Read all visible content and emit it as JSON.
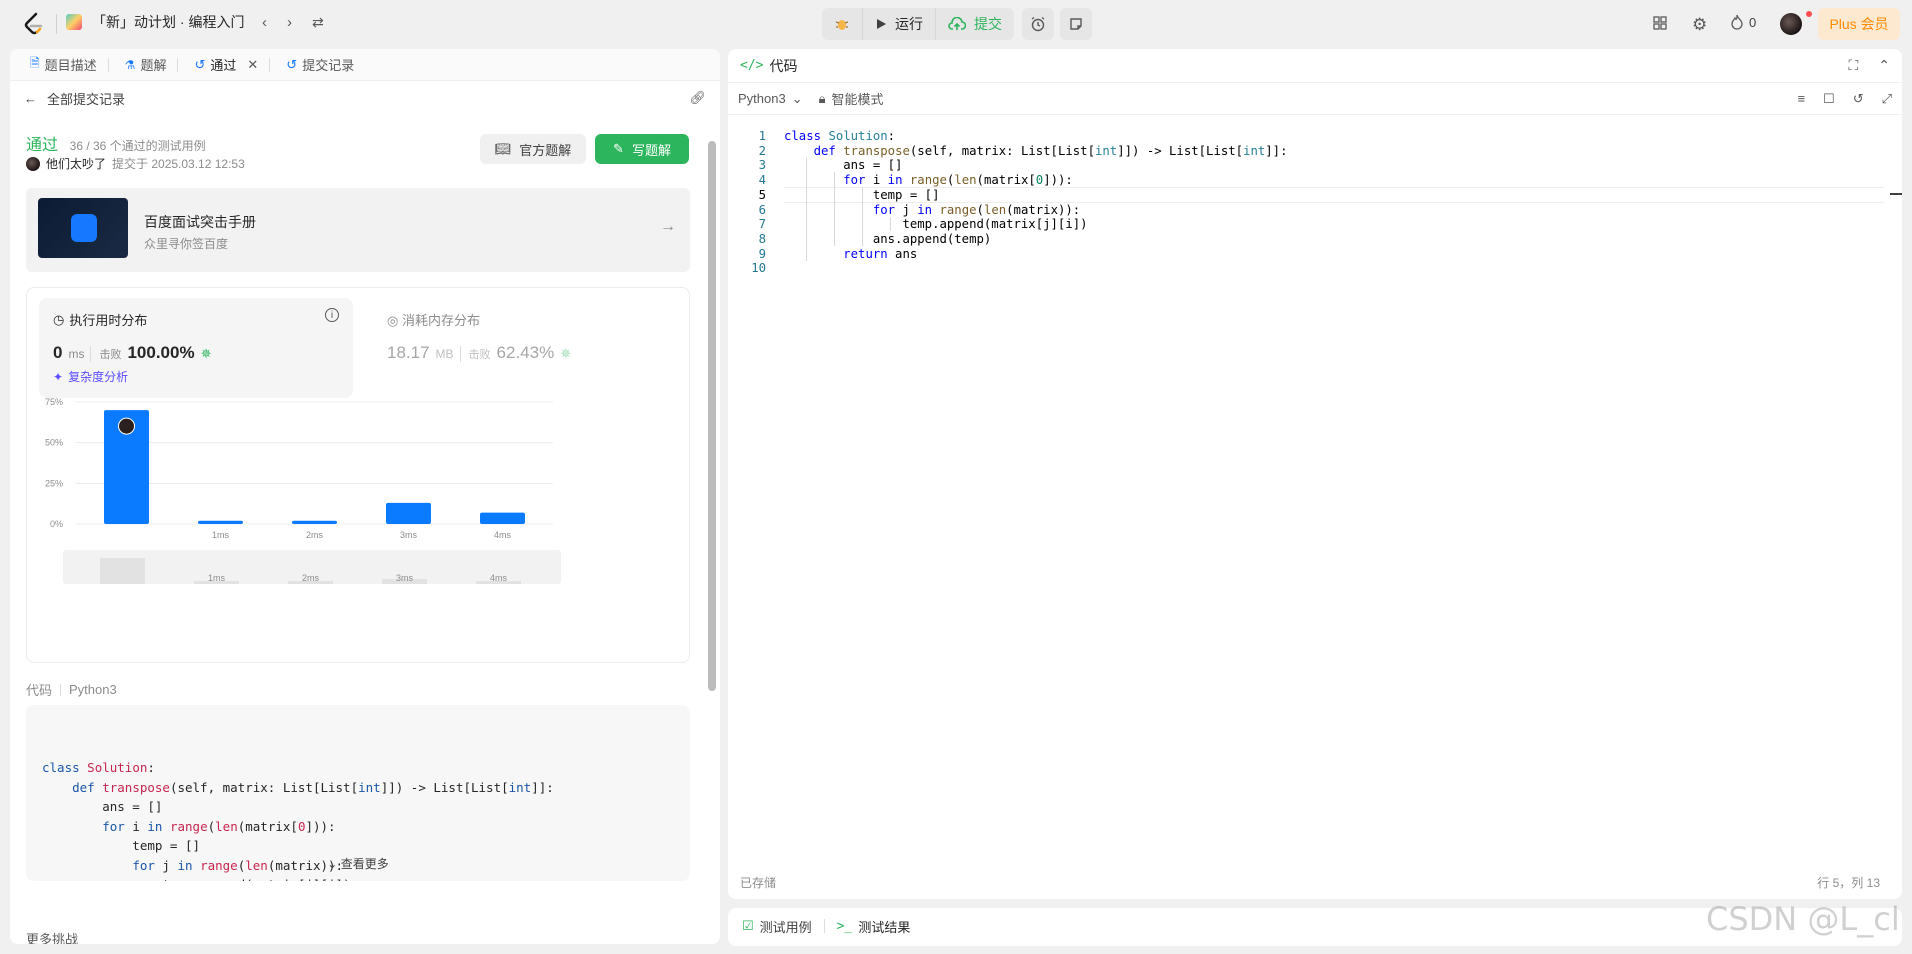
{
  "header": {
    "plan_title": "「新」动计划 · 编程入门",
    "run_label": "运行",
    "submit_label": "提交",
    "fire_count": "0",
    "plus_label": "Plus 会员"
  },
  "left_tabs": [
    "题目描述",
    "题解",
    "通过",
    "提交记录"
  ],
  "back_label": "全部提交记录",
  "result": {
    "status": "通过",
    "cases": "36 / 36 个通过的测试用例",
    "user": "他们太吵了",
    "submitted_at": "提交于 2025.03.12 12:53",
    "official_btn": "官方题解",
    "write_btn": "写题解"
  },
  "ad": {
    "title": "百度面试突击手册",
    "subtitle": "众里寻你签百度"
  },
  "runtime": {
    "title": "执行用时分布",
    "value": "0",
    "unit": "ms",
    "beat_label": "击败",
    "beat": "100.00%",
    "analysis": "复杂度分析"
  },
  "memory": {
    "title": "消耗内存分布",
    "value": "18.17",
    "unit": "MB",
    "beat_label": "击败",
    "beat": "62.43%"
  },
  "chart_data": {
    "type": "bar",
    "categories": [
      "",
      "1ms",
      "2ms",
      "3ms",
      "4ms"
    ],
    "values": [
      70,
      2,
      2,
      13,
      7
    ],
    "y_ticks": [
      "0%",
      "25%",
      "50%",
      "75%"
    ],
    "ylim": [
      0,
      75
    ],
    "grid": true,
    "color": "#0a7aff"
  },
  "code_meta": {
    "label": "代码",
    "lang": "Python3"
  },
  "code_snippet": [
    "class Solution:",
    "    def transpose(self, matrix: List[List[int]]) -> List[List[int]]:",
    "        ans = []",
    "        for i in range(len(matrix[0])):",
    "            temp = []",
    "            for j in range(len(matrix)):",
    "                temp.append(matrix[j][i])",
    "            ans.append(temp)"
  ],
  "see_more": "查看更多",
  "more_challenges": "更多挑战",
  "editor": {
    "title": "代码",
    "lang": "Python3",
    "mode": "智能模式",
    "saved": "已存储",
    "cursor": "行 5，列 13",
    "lines": [
      "class Solution:",
      "    def transpose(self, matrix: List[List[int]]) -> List[List[int]]:",
      "        ans = []",
      "        for i in range(len(matrix[0])):",
      "            temp = []",
      "            for j in range(len(matrix)):",
      "                temp.append(matrix[j][i])",
      "            ans.append(temp)",
      "        return ans",
      ""
    ]
  },
  "bottom_tabs": [
    "测试用例",
    "测试结果"
  ],
  "watermark": "CSDN @L_cl"
}
